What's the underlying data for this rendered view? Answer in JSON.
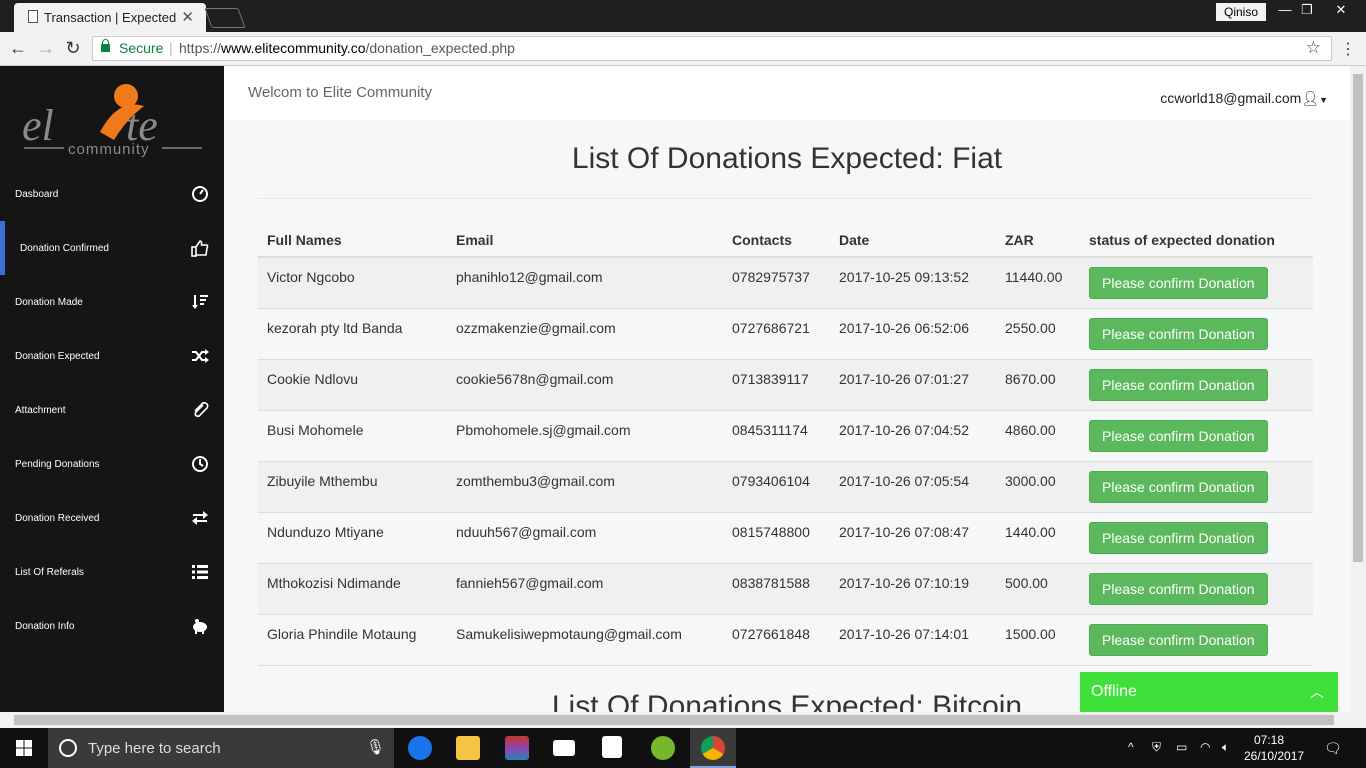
{
  "browser": {
    "tab_title": "Transaction | Expected",
    "tab_close": "✕",
    "profile_name": "Qiniso",
    "secure_label": "Secure",
    "url_scheme": "https://",
    "url_host": "www.elitecommunity.co",
    "url_path": "/donation_expected.php",
    "win_min": "—",
    "win_restore": "❐",
    "win_close": "✕"
  },
  "sidebar": {
    "items": [
      {
        "label": "Dasboard",
        "icon": "dashboard-icon"
      },
      {
        "label": "Donation Confirmed",
        "icon": "thumbs-up-icon",
        "active": true
      },
      {
        "label": "Donation Made",
        "icon": "sort-icon"
      },
      {
        "label": "Donation Expected",
        "icon": "shuffle-icon"
      },
      {
        "label": "Attachment",
        "icon": "paperclip-icon"
      },
      {
        "label": "Pending Donations",
        "icon": "clock-icon"
      },
      {
        "label": "Donation Received",
        "icon": "exchange-icon"
      },
      {
        "label": "List Of Referals",
        "icon": "list-icon"
      },
      {
        "label": "Donation Info",
        "icon": "piggy-bank-icon"
      }
    ]
  },
  "header": {
    "welcome": "Welcom to Elite Community",
    "user_email": "ccworld18@gmail.com"
  },
  "main": {
    "title": "List Of Donations Expected: Fiat",
    "title2": "List Of Donations Expected: Bitcoin",
    "columns": [
      "Full Names",
      "Email",
      "Contacts",
      "Date",
      "ZAR",
      "status of expected donation"
    ],
    "rows": [
      {
        "name": "Victor Ngcobo",
        "email": "phanihlo12@gmail.com",
        "contact": "0782975737",
        "date": "2017-10-25 09:13:52",
        "zar": "11440.00",
        "action": "Please confirm Donation"
      },
      {
        "name": "kezorah pty ltd Banda",
        "email": "ozzmakenzie@gmail.com",
        "contact": "0727686721",
        "date": "2017-10-26 06:52:06",
        "zar": "2550.00",
        "action": "Please confirm Donation"
      },
      {
        "name": "Cookie Ndlovu",
        "email": "cookie5678n@gmail.com",
        "contact": "0713839117",
        "date": "2017-10-26 07:01:27",
        "zar": "8670.00",
        "action": "Please confirm Donation"
      },
      {
        "name": "Busi Mohomele",
        "email": "Pbmohomele.sj@gmail.com",
        "contact": "0845311174",
        "date": "2017-10-26 07:04:52",
        "zar": "4860.00",
        "action": "Please confirm Donation"
      },
      {
        "name": "Zibuyile Mthembu",
        "email": "zomthembu3@gmail.com",
        "contact": "0793406104",
        "date": "2017-10-26 07:05:54",
        "zar": "3000.00",
        "action": "Please confirm Donation"
      },
      {
        "name": "Ndunduzo Mtiyane",
        "email": "nduuh567@gmail.com",
        "contact": "0815748800",
        "date": "2017-10-26 07:08:47",
        "zar": "1440.00",
        "action": "Please confirm Donation"
      },
      {
        "name": "Mthokozisi Ndimande",
        "email": "fannieh567@gmail.com",
        "contact": "0838781588",
        "date": "2017-10-26 07:10:19",
        "zar": "500.00",
        "action": "Please confirm Donation"
      },
      {
        "name": "Gloria Phindile Motaung",
        "email": "Samukelisiwepmotaung@gmail.com",
        "contact": "0727661848",
        "date": "2017-10-26 07:14:01",
        "zar": "1500.00",
        "action": "Please confirm Donation"
      }
    ]
  },
  "chat": {
    "status": "Offline"
  },
  "taskbar": {
    "search_placeholder": "Type here to search",
    "time": "07:18",
    "date": "26/10/2017"
  },
  "colors": {
    "accent": "#3e6fd6",
    "confirm_button": "#5cb85c",
    "offline_widget": "#3fe03a"
  }
}
